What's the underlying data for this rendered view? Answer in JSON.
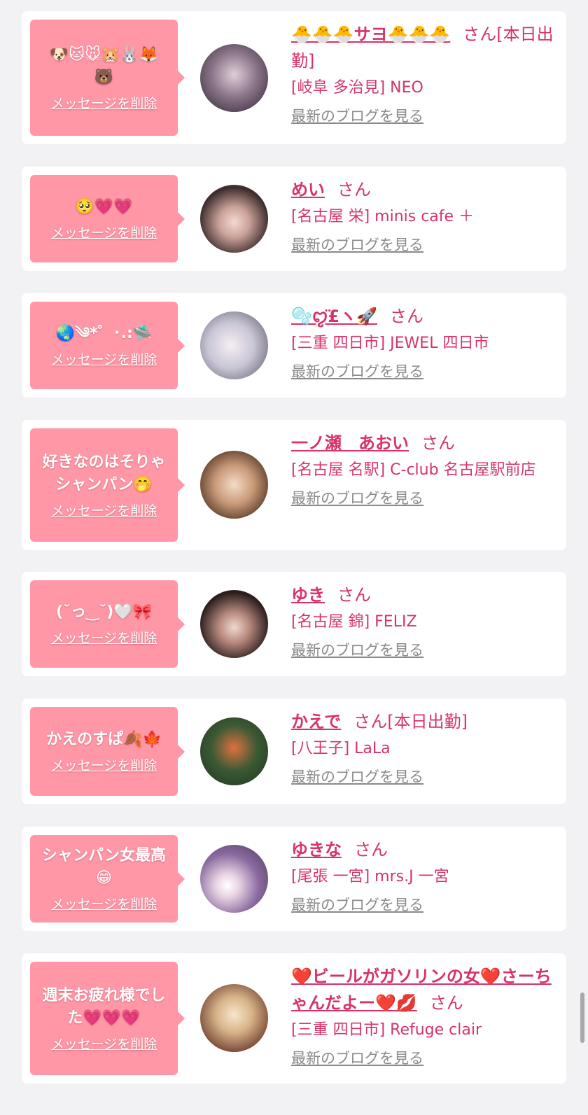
{
  "delete_label": "メッセージを削除",
  "san_label": "さん",
  "blog_label": "最新のブログを見る",
  "colors": {
    "accent": "#d8326a",
    "bubble": "#ff97a6",
    "background": "#f2f2f4"
  },
  "cards": [
    {
      "message": "🐶🐱🐭🐹🐰🦊🐻",
      "name": "🐣🐣🐣サヨ🐣🐣🐣",
      "suffix": "[本日出勤]",
      "shop": "[岐阜 多治見] NEO",
      "avatar_icon": "avatar-photo"
    },
    {
      "message": "🥺💗💗",
      "name": "めい",
      "suffix": "",
      "shop": "[名古屋 栄] minis cafe ＋",
      "avatar_icon": "avatar-photo"
    },
    {
      "message": "🌏༄*゜･.:🛸",
      "name": "🫧ꨄ̈£ヽ🚀",
      "suffix": "",
      "shop": "[三重 四日市] JEWEL 四日市",
      "avatar_icon": "avatar-photo"
    },
    {
      "message": "好きなのはそりゃシャンパン🤭",
      "name": "一ノ瀬　あおい",
      "suffix": "",
      "shop": "[名古屋 名駅] C-club 名古屋駅前店",
      "avatar_icon": "avatar-photo"
    },
    {
      "message": "(˘っ‿˘)🤍🎀",
      "name": "ゆき",
      "suffix": "",
      "shop": "[名古屋 錦] FELIZ",
      "avatar_icon": "avatar-photo"
    },
    {
      "message": "かえのすぱ🍂🍁",
      "name": "かえで",
      "suffix": "[本日出勤]",
      "shop": "[八王子] LaLa",
      "avatar_icon": "avatar-photo"
    },
    {
      "message": "シャンパン女最高😁",
      "name": "ゆきな",
      "suffix": "",
      "shop": "[尾張 一宮] mrs.J 一宮",
      "avatar_icon": "avatar-photo"
    },
    {
      "message": "週末お疲れ様でした💗💗💗",
      "name": "❤️ビールがガソリンの女❤️さーちゃんだよー❤️💋",
      "suffix": "",
      "shop": "[三重 四日市] Refuge clair",
      "avatar_icon": "avatar-photo"
    }
  ]
}
